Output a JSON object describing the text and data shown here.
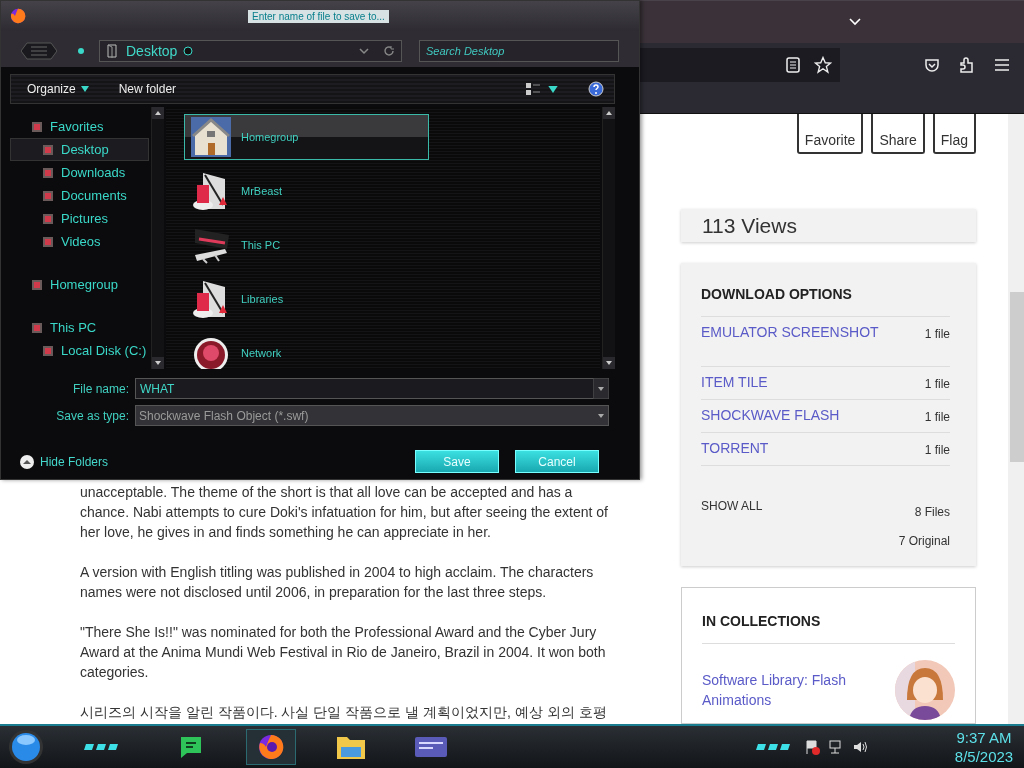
{
  "browser": {
    "article": [
      "unacceptable. The theme of the short is that all love can be accepted and has a chance. Nabi attempts to cure Doki's infatuation for him, but after seeing the extent of her love, he gives in and finds something he can appreciate in her.",
      "A version with English titling was published in 2004 to high acclaim. The characters names were not disclosed until 2006, in preparation for the last three steps.",
      "\"There She Is!!\" was nominated for both the Professional Award and the Cyber Jury Award at the Anima Mundi Web Festival in Rio de Janeiro, Brazil in 2004. It won both categories.",
      "시리즈의 시작을 알린 작품이다. 사실 단일 작품으로 낼 계획이었지만, 예상 외의 호평"
    ],
    "actions": [
      "Favorite",
      "Share",
      "Flag"
    ],
    "views": "113 Views",
    "downloads": {
      "title": "DOWNLOAD OPTIONS",
      "items": [
        {
          "label": "EMULATOR SCREENSHOT",
          "count": "1 file"
        },
        {
          "label": "ITEM TILE",
          "count": "1 file"
        },
        {
          "label": "SHOCKWAVE FLASH",
          "count": "1 file"
        },
        {
          "label": "TORRENT",
          "count": "1 file"
        }
      ],
      "show_all": "SHOW ALL",
      "totals": [
        "8 Files",
        "7 Original"
      ]
    },
    "collections": {
      "title": "IN COLLECTIONS",
      "items": [
        {
          "label": "Software Library: Flash Animations"
        }
      ]
    }
  },
  "dialog": {
    "title": "Enter name of file to save to...",
    "location": "Desktop",
    "search": {
      "placeholder": "Search Desktop"
    },
    "toolbar": [
      {
        "label": "Organize",
        "kind": "menu"
      },
      {
        "label": "New folder",
        "kind": "button"
      }
    ],
    "nav": [
      {
        "label": "Favorites",
        "selected": false,
        "children": [
          {
            "label": "Desktop",
            "selected": true
          },
          {
            "label": "Downloads",
            "selected": false
          },
          {
            "label": "Documents",
            "selected": false
          },
          {
            "label": "Pictures",
            "selected": false
          },
          {
            "label": "Videos",
            "selected": false
          }
        ]
      },
      {
        "label": "Homegroup",
        "selected": false
      },
      {
        "label": "This PC",
        "selected": false,
        "children": [
          {
            "label": "Local Disk (C:)",
            "selected": false
          }
        ]
      }
    ],
    "files": [
      {
        "name": "Homegroup",
        "kind": "house",
        "selected": true
      },
      {
        "name": "MrBeast",
        "kind": "library",
        "selected": false
      },
      {
        "name": "This PC",
        "kind": "computer",
        "selected": false
      },
      {
        "name": "Libraries",
        "kind": "library",
        "selected": false
      },
      {
        "name": "Network",
        "kind": "network",
        "selected": false
      }
    ],
    "file_name": {
      "label": "File name:",
      "value": "WHAT"
    },
    "save_type": {
      "label": "Save as type:",
      "value": "Shockwave Flash Object (*.swf)"
    },
    "hide_folders": "Hide Folders",
    "buttons": [
      "Save",
      "Cancel"
    ]
  },
  "taskbar": {
    "time": "9:37 AM",
    "date": "8/5/2023"
  }
}
